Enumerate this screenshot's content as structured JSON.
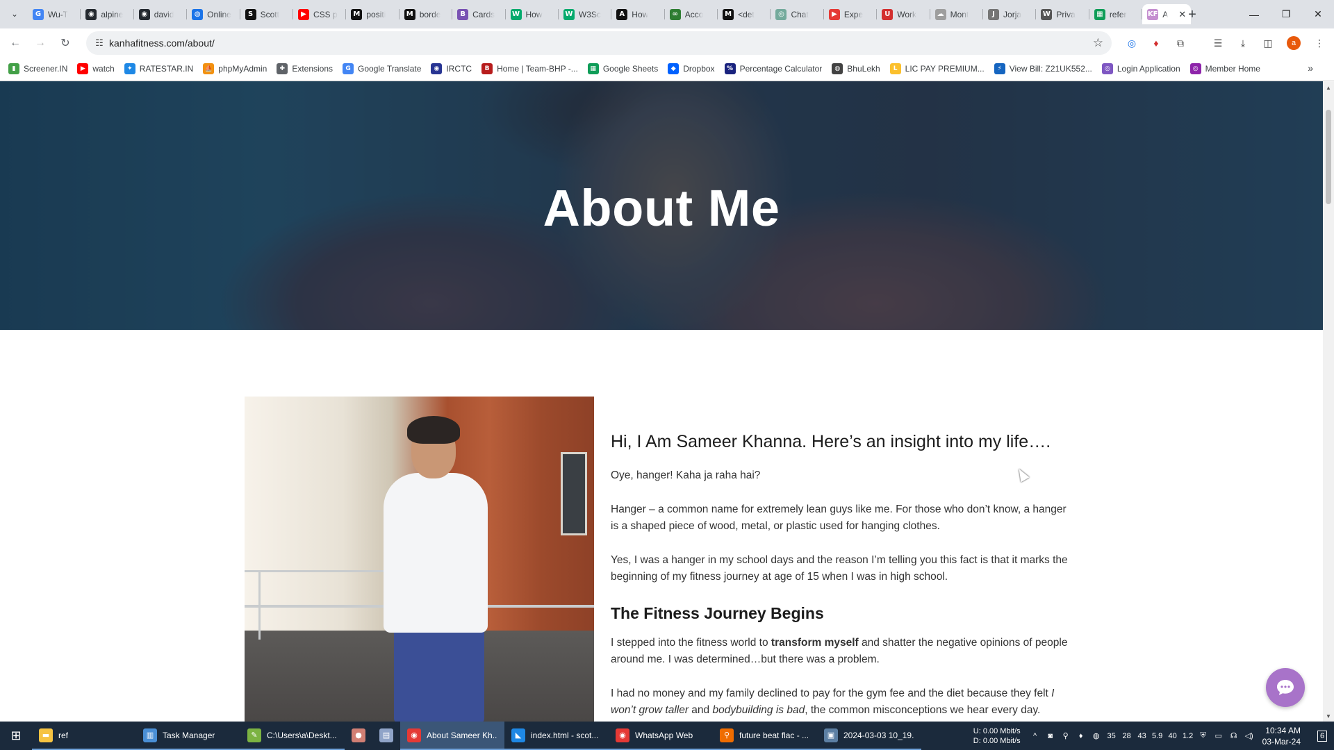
{
  "browser": {
    "tabs": [
      {
        "label": "Wu-T",
        "icon": "google-icon",
        "color": "#4285f4",
        "glyph": "G"
      },
      {
        "label": "alpine",
        "icon": "github-icon",
        "color": "#24292f",
        "glyph": "◉"
      },
      {
        "label": "david",
        "icon": "github-icon",
        "color": "#24292f",
        "glyph": "◉"
      },
      {
        "label": "Online",
        "icon": "globe-icon",
        "color": "#1a73e8",
        "glyph": "◍"
      },
      {
        "label": "Scott",
        "icon": "s-icon",
        "color": "#111111",
        "glyph": "S"
      },
      {
        "label": "CSS p",
        "icon": "youtube-icon",
        "color": "#ff0000",
        "glyph": "▶"
      },
      {
        "label": "positi",
        "icon": "medium-icon",
        "color": "#111111",
        "glyph": "M"
      },
      {
        "label": "borde",
        "icon": "medium-icon",
        "color": "#111111",
        "glyph": "M"
      },
      {
        "label": "Cards",
        "icon": "bootstrap-icon",
        "color": "#7952b3",
        "glyph": "B"
      },
      {
        "label": "How",
        "icon": "w-icon",
        "color": "#04aa6d",
        "glyph": "W"
      },
      {
        "label": "W3Sc",
        "icon": "w-icon",
        "color": "#04aa6d",
        "glyph": "W"
      },
      {
        "label": "How",
        "icon": "a-icon",
        "color": "#111111",
        "glyph": "A"
      },
      {
        "label": "Acco",
        "icon": "link-icon",
        "color": "#2e7d32",
        "glyph": "∞"
      },
      {
        "label": "<det",
        "icon": "medium-icon",
        "color": "#111111",
        "glyph": "M"
      },
      {
        "label": "Chat",
        "icon": "chatgpt-icon",
        "color": "#74aa9c",
        "glyph": "◎"
      },
      {
        "label": "Expe",
        "icon": "red-app-icon",
        "color": "#e53935",
        "glyph": "▶"
      },
      {
        "label": "Work",
        "icon": "red-app-icon",
        "color": "#d32f2f",
        "glyph": "U"
      },
      {
        "label": "Mont",
        "icon": "cloud-icon",
        "color": "#9e9e9e",
        "glyph": "☁"
      },
      {
        "label": "Jorja",
        "icon": "j-icon",
        "color": "#757575",
        "glyph": "J"
      },
      {
        "label": "Priva",
        "icon": "wikipedia-icon",
        "color": "#555555",
        "glyph": "W"
      },
      {
        "label": "refer",
        "icon": "sheets-icon",
        "color": "#0f9d58",
        "glyph": "▦"
      },
      {
        "label": "A",
        "icon": "kf-icon",
        "color": "#c58fd0",
        "glyph": "KF",
        "active": true
      }
    ],
    "new_tab_symbol": "+",
    "window_controls": {
      "minimize": "—",
      "restore": "❐",
      "close": "✕"
    },
    "nav": {
      "back": "←",
      "forward": "→",
      "reload": "↻"
    },
    "url": "kanhafitness.com/about/",
    "star": "☆",
    "extensions": [
      "◎",
      "♦",
      "⧉",
      "☰",
      "⤓",
      "◫"
    ],
    "profile_initial": "a",
    "menu": "⋮",
    "bookmarks": [
      {
        "label": "Screener.IN",
        "icon": "screener-icon",
        "color": "#43a047",
        "glyph": "▮"
      },
      {
        "label": "watch",
        "icon": "youtube-icon",
        "color": "#ff0000",
        "glyph": "▶"
      },
      {
        "label": "RATESTAR.IN",
        "icon": "ratestar-icon",
        "color": "#1e88e5",
        "glyph": "✦"
      },
      {
        "label": "phpMyAdmin",
        "icon": "phpmyadmin-icon",
        "color": "#f29111",
        "glyph": "⛵"
      },
      {
        "label": "Extensions",
        "icon": "puzzle-icon",
        "color": "#5f6368",
        "glyph": "✚"
      },
      {
        "label": "Google Translate",
        "icon": "translate-icon",
        "color": "#4285f4",
        "glyph": "G"
      },
      {
        "label": "IRCTC",
        "icon": "irctc-icon",
        "color": "#283593",
        "glyph": "◉"
      },
      {
        "label": "Home | Team-BHP -...",
        "icon": "teambhp-icon",
        "color": "#b71c1c",
        "glyph": "B"
      },
      {
        "label": "Google Sheets",
        "icon": "sheets-icon",
        "color": "#0f9d58",
        "glyph": "▦"
      },
      {
        "label": "Dropbox",
        "icon": "dropbox-icon",
        "color": "#0061fe",
        "glyph": "◆"
      },
      {
        "label": "Percentage Calculator",
        "icon": "calc-icon",
        "color": "#1a237e",
        "glyph": "%"
      },
      {
        "label": "BhuLekh",
        "icon": "globe-icon",
        "color": "#424242",
        "glyph": "◍"
      },
      {
        "label": "LIC PAY PREMIUM...",
        "icon": "lic-icon",
        "color": "#fbc02d",
        "glyph": "L"
      },
      {
        "label": "View Bill: Z21UK552...",
        "icon": "bill-icon",
        "color": "#1565c0",
        "glyph": "⚡"
      },
      {
        "label": "Login Application",
        "icon": "login-icon",
        "color": "#7e57c2",
        "glyph": "◎"
      },
      {
        "label": "Member Home",
        "icon": "member-icon",
        "color": "#8e24aa",
        "glyph": "◎"
      }
    ],
    "bookmarks_more": "»"
  },
  "page": {
    "hero_title": "About Me",
    "intro_heading": "Hi, I Am Sameer Khanna. Here’s an insight into my life….",
    "p1": "Oye, hanger! Kaha ja raha hai?",
    "p2": "Hanger – a common name for extremely lean guys like me. For those who don’t know, a hanger is a shaped piece of wood, metal, or plastic used for hanging clothes.",
    "p3": "Yes, I was a hanger in my school days and the reason I’m telling you this fact is that it marks the beginning of my fitness journey at age of 15 when I was in high school.",
    "journey_heading": "The Fitness Journey Begins",
    "p4_before": "I stepped into the fitness world to ",
    "p4_bold": "transform myself",
    "p4_after": " and shatter the negative opinions of people around me. I was determined…but there was a problem.",
    "p5_before": "I had no money and my family declined to pay for the gym fee and the diet because they felt ",
    "p5_italic1": "I won’t grow taller",
    "p5_mid": " and ",
    "p5_italic2": "bodybuilding is bad",
    "p5_after": ", the common misconceptions we hear every day.",
    "chat_symbol": "💬"
  },
  "taskbar": {
    "start": "⊞",
    "items": [
      {
        "label": "ref",
        "icon": "folder-icon",
        "color": "#f6c342",
        "glyph": "▬"
      },
      {
        "label": "Task Manager",
        "icon": "task-manager-icon",
        "color": "#4a8fd6",
        "glyph": "▥"
      },
      {
        "label": "C:\\Users\\a\\Deskt...",
        "icon": "notepad-icon",
        "color": "#7cb342",
        "glyph": "✎"
      },
      {
        "label": "",
        "icon": "app-icon",
        "color": "#d17f74",
        "glyph": "●"
      },
      {
        "label": "",
        "icon": "document-icon",
        "color": "#90a4c8",
        "glyph": "▤"
      },
      {
        "label": "About Sameer Kh...",
        "icon": "chrome-icon",
        "color": "#e53935",
        "glyph": "◉",
        "active": true
      },
      {
        "label": "index.html - scot...",
        "icon": "vscode-icon",
        "color": "#1e88e5",
        "glyph": "◣"
      },
      {
        "label": "WhatsApp Web",
        "icon": "chrome-icon",
        "color": "#e53935",
        "glyph": "◉"
      },
      {
        "label": "future beat flac - ...",
        "icon": "search-icon",
        "color": "#ef6c00",
        "glyph": "⚲"
      },
      {
        "label": "2024-03-03 10_19...",
        "icon": "image-icon",
        "color": "#5c7fa3",
        "glyph": "▣"
      }
    ],
    "net_up": "U:   0.00 Mbit/s",
    "net_down": "D:   0.00 Mbit/s",
    "tray_icons": [
      "^",
      "◙",
      "⚲",
      "♦",
      "◍",
      "35",
      "28",
      "43",
      "5.9",
      "40",
      "1.2",
      "⛨",
      "▭",
      "☊",
      "◁)"
    ],
    "time": "10:34 AM",
    "date": "03-Mar-24",
    "notifications": "6"
  }
}
